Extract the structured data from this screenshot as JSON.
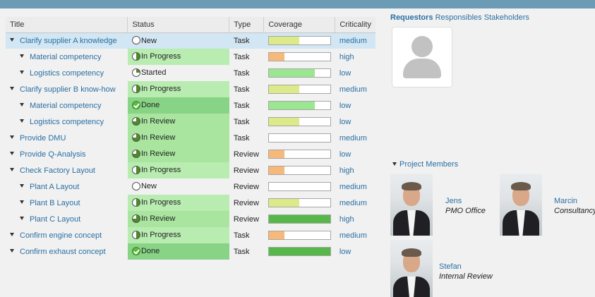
{
  "colors": {
    "accent_blue": "#2a6fa3",
    "frame_bg": "#6b9bb5"
  },
  "table": {
    "headers": {
      "title": "Title",
      "status": "Status",
      "type": "Type",
      "coverage": "Coverage",
      "criticality": "Criticality"
    },
    "rows": [
      {
        "title": "Clarify supplier A knowledge",
        "level": 1,
        "status": "New",
        "status_kind": "new",
        "type": "Task",
        "coverage": 0.5,
        "coverage_color": "#dcea8a",
        "criticality": "medium",
        "selected": true
      },
      {
        "title": "Material competency",
        "level": 2,
        "status": "In Progress",
        "status_kind": "progress",
        "type": "Task",
        "coverage": 0.25,
        "coverage_color": "#f7b97a",
        "criticality": "high"
      },
      {
        "title": "Logistics competency",
        "level": 2,
        "status": "Started",
        "status_kind": "started",
        "type": "Task",
        "coverage": 0.75,
        "coverage_color": "#9be690",
        "criticality": "low"
      },
      {
        "title": "Clarify supplier B know-how",
        "level": 1,
        "status": "In Progress",
        "status_kind": "progress",
        "type": "Task",
        "coverage": 0.5,
        "coverage_color": "#dcea8a",
        "criticality": "medium"
      },
      {
        "title": "Material competency",
        "level": 2,
        "status": "Done",
        "status_kind": "done",
        "type": "Task",
        "coverage": 0.75,
        "coverage_color": "#9be690",
        "criticality": "low"
      },
      {
        "title": "Logistics competency",
        "level": 2,
        "status": "In Review",
        "status_kind": "review",
        "type": "Task",
        "coverage": 0.5,
        "coverage_color": "#dcea8a",
        "criticality": "low"
      },
      {
        "title": "Provide DMU",
        "level": 1,
        "status": "In Review",
        "status_kind": "review",
        "type": "Task",
        "coverage": 0.0,
        "coverage_color": "#ffffff",
        "criticality": "medium"
      },
      {
        "title": "Provide Q-Analysis",
        "level": 1,
        "status": "In Review",
        "status_kind": "review",
        "type": "Review",
        "coverage": 0.25,
        "coverage_color": "#f7b97a",
        "criticality": "low"
      },
      {
        "title": "Check Factory Layout",
        "level": 1,
        "status": "In Progress",
        "status_kind": "progress",
        "type": "Review",
        "coverage": 0.25,
        "coverage_color": "#f7b97a",
        "criticality": "high"
      },
      {
        "title": "Plant A Layout",
        "level": 2,
        "status": "New",
        "status_kind": "new",
        "type": "Review",
        "coverage": 0.0,
        "coverage_color": "#ffffff",
        "criticality": "medium"
      },
      {
        "title": "Plant B Layout",
        "level": 2,
        "status": "In Progress",
        "status_kind": "progress",
        "type": "Review",
        "coverage": 0.5,
        "coverage_color": "#dcea8a",
        "criticality": "medium"
      },
      {
        "title": "Plant C Layout",
        "level": 2,
        "status": "In Review",
        "status_kind": "review",
        "type": "Review",
        "coverage": 1.0,
        "coverage_color": "#57b84a",
        "criticality": "high"
      },
      {
        "title": "Confirm engine concept",
        "level": 1,
        "status": "In Progress",
        "status_kind": "progress",
        "type": "Task",
        "coverage": 0.25,
        "coverage_color": "#f7b97a",
        "criticality": "medium"
      },
      {
        "title": "Confirm exhaust concept",
        "level": 1,
        "status": "Done",
        "status_kind": "done",
        "type": "Task",
        "coverage": 1.0,
        "coverage_color": "#57b84a",
        "criticality": "low"
      }
    ]
  },
  "right_panel": {
    "tabs": [
      "Requestors",
      "Responsibles",
      "Stakeholders"
    ],
    "active_tab": "Requestors",
    "members_header": "Project Members",
    "members": [
      {
        "name": "Jens",
        "role": "PMO Office"
      },
      {
        "name": "Marcin",
        "role": "Consultancy"
      },
      {
        "name": "Stefan",
        "role": "Internal Review"
      }
    ]
  }
}
